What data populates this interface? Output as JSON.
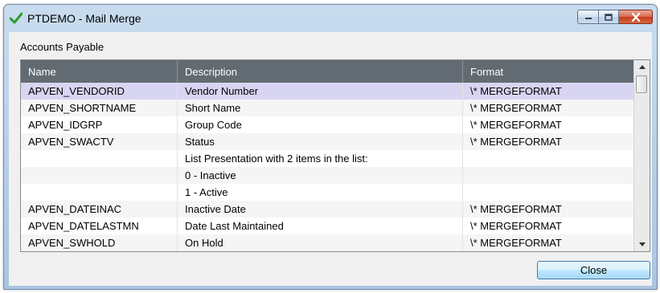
{
  "window": {
    "title": "PTDEMO - Mail Merge",
    "icon": "green-check-icon"
  },
  "group_label": "Accounts Payable",
  "grid": {
    "columns": [
      "Name",
      "Description",
      "Format"
    ],
    "rows": [
      {
        "name": "APVEN_VENDORID",
        "description": "Vendor Number",
        "format": "\\* MERGEFORMAT",
        "selected": true
      },
      {
        "name": "APVEN_SHORTNAME",
        "description": "Short Name",
        "format": "\\* MERGEFORMAT"
      },
      {
        "name": "APVEN_IDGRP",
        "description": "Group Code",
        "format": "\\* MERGEFORMAT"
      },
      {
        "name": "APVEN_SWACTV",
        "description": "Status",
        "format": "\\* MERGEFORMAT"
      },
      {
        "name": "",
        "description": "List Presentation with 2 items in the list:",
        "format": ""
      },
      {
        "name": "",
        "description": "0 - Inactive",
        "format": ""
      },
      {
        "name": "",
        "description": "1 - Active",
        "format": ""
      },
      {
        "name": "APVEN_DATEINAC",
        "description": "Inactive Date",
        "format": "\\* MERGEFORMAT"
      },
      {
        "name": "APVEN_DATELASTMN",
        "description": "Date Last Maintained",
        "format": "\\* MERGEFORMAT"
      },
      {
        "name": "APVEN_SWHOLD",
        "description": "On Hold",
        "format": "\\* MERGEFORMAT"
      }
    ]
  },
  "buttons": {
    "close_label": "Close"
  }
}
